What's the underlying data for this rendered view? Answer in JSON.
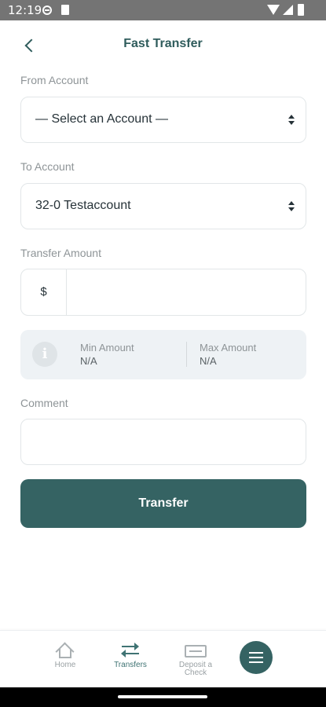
{
  "status_bar": {
    "time": "12:19",
    "icons": [
      "globe-icon",
      "sd-card-icon",
      "wifi-icon",
      "signal-icon",
      "battery-icon"
    ]
  },
  "header": {
    "title": "Fast Transfer",
    "back_icon": "chevron-left-icon"
  },
  "from_account": {
    "label": "From Account",
    "value": "— Select an Account —"
  },
  "to_account": {
    "label": "To Account",
    "value": "32-0 Testaccount"
  },
  "transfer_amount": {
    "label": "Transfer Amount",
    "currency": "$",
    "value": ""
  },
  "limits": {
    "icon": "info-icon",
    "min_label": "Min Amount",
    "min_value": "N/A",
    "max_label": "Max Amount",
    "max_value": "N/A"
  },
  "comment": {
    "label": "Comment",
    "value": ""
  },
  "actions": {
    "transfer_label": "Transfer"
  },
  "bottom_nav": {
    "items": [
      {
        "label": "Home",
        "icon": "home-icon",
        "active": false
      },
      {
        "label": "Transfers",
        "icon": "transfer-arrows-icon",
        "active": true
      },
      {
        "label": "Deposit a Check",
        "icon": "check-icon",
        "active": false
      }
    ],
    "menu_icon": "hamburger-menu-icon"
  },
  "colors": {
    "primary": "#356363",
    "title": "#2f5c5c",
    "label_gray": "#8e9497",
    "info_bg": "#eef2f5",
    "status_bar": "#747474"
  }
}
